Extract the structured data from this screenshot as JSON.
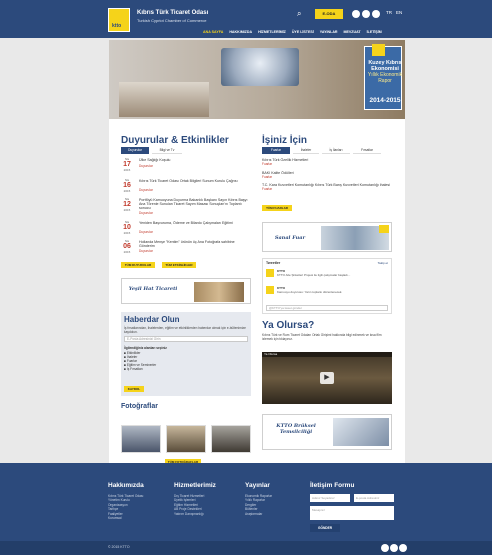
{
  "header": {
    "logo_text": "ktto",
    "title": "Kıbrıs Türk Ticaret Odası",
    "subtitle": "Turkish Cypriot Chamber of Commerce",
    "search_icon": "search-icon",
    "member_button": "E-ODA",
    "social": [
      "facebook-icon",
      "twitter-icon",
      "youtube-icon"
    ],
    "languages": [
      "TR",
      "EN"
    ],
    "nav": [
      "ANA SAYFA",
      "HAKKIMIZDA",
      "HİZMETLERİMİZ",
      "ÜYE LİSTESİ",
      "YAYINLAR",
      "MEVZUAT",
      "İLETİŞİM"
    ]
  },
  "banner": {
    "book_title": "Kuzey Kıbrıs Ekonomisi",
    "book_subtitle": "Yıllık Ekonomik Rapor",
    "book_years": "2014-2015"
  },
  "announcements": {
    "title": "Duyurular & Etkinlikler",
    "tabs": [
      "Duyurular",
      "Bilgi ve Tv"
    ],
    "events": [
      {
        "month": "Nis",
        "day": "17",
        "year": "2015",
        "title": "Ülke Sağlığı Koşulu",
        "category": "Duyurular"
      },
      {
        "month": "Nis",
        "day": "16",
        "year": "2015",
        "title": "Kıbrıs Türk Ticaret Odası Ortak Bilgileri Sunum Kurulu Çağrısı",
        "category": "Duyurular"
      },
      {
        "month": "Nis",
        "day": "12",
        "year": "2015",
        "title": "Portföyü Kamuoyuna Duyurma Bakanlık Başkanı Sayın Kıbrıs Başyı Ana Törenle Sunulan Ticaret Sayım Masası Sonuçları'nı Toplantı sonucu",
        "category": "Duyurular"
      },
      {
        "month": "Nis",
        "day": "10",
        "year": "2015",
        "title": "Yeniden Başvuruma, Ödeme ve Bilardo Çalışmaları Eğitimi",
        "category": "Duyurular"
      },
      {
        "month": "Nis",
        "day": "06",
        "year": "2015",
        "title": "Hollanda Menşe \"Kentim\" ürünün üç Ana Fotoğrafa sahibine Gönderim",
        "category": "Duyurular"
      }
    ],
    "btn_all": "TÜM DUYURULAR",
    "btn_events": "TÜM ETKİNLİKLER"
  },
  "jobs": {
    "title": "İşiniz İçin",
    "tabs": [
      "Fuarlar",
      "İhaleler",
      "İş İlanları",
      "Fırsatlar"
    ],
    "items": [
      {
        "title": "Kıbrıs Türk Özellik Hizmetleri",
        "category": "Fuarlar"
      },
      {
        "title": "BAKI Kalite Ödülleri",
        "category": "Fuarlar"
      },
      {
        "title": "T.C. Kara Kuvvetleri Komutanlığı Kıbrıs Türk Barış Kuvvetleri Komutanlığı ihalesi",
        "category": "Fuarlar"
      }
    ],
    "btn_all": "TÜM FUARLAR"
  },
  "promo": {
    "fair_label": "Sanal Fuar",
    "trade_label": "Yeşil Hat Ticareti",
    "brussels_label": "KTTO Brüksel Temsilciliği"
  },
  "twitter": {
    "header": "Tweetler",
    "follow": "Takip et",
    "tweets": [
      {
        "user": "KTTO",
        "text": "KTTO Aile Şirketleri Projesi ile ilgili çalışmalar başladı..."
      },
      {
        "user": "KTTO",
        "text": "Kamuoyu duyurusu: Yarın toplantı düzenlenecek."
      }
    ],
    "compose": "@KTTO'ya tweet gönder"
  },
  "newsletter": {
    "title": "Haberdar Olun",
    "desc": "İş fırsatlarından, ihalelerden, eğitim ve etkinliklerden haberdar olmak için e-bültenimize kaydolun.",
    "email_placeholder": "E-Posta Adresinizi Girin",
    "interests_label": "İlgilendiğiniz alanları seçiniz",
    "options": [
      "Etkinlikler",
      "İhaleler",
      "Fuarlar",
      "Eğitim ve Seminerler",
      "İş Fırsatları"
    ],
    "submit": "KAYDOL"
  },
  "whatif": {
    "title": "Ya Olursa?",
    "desc": "Kıbrıs Türk ve Rum Ticaret Odaları Ortak Girişimi hakkında bilgi edinmek ve kısa film izlemek için tıklayınız.",
    "video_label": "Ya Olursa"
  },
  "photos": {
    "title": "Fotoğraflar",
    "btn_all": "TÜM FOTOĞRAFLAR"
  },
  "footer": {
    "about": {
      "title": "Hakkımızda",
      "links": [
        "Kıbrıs Türk Ticaret Odası",
        "Yönetim Kurulu",
        "Organizasyon",
        "Tarihçe",
        "Faaliyetler",
        "Kurumsal"
      ]
    },
    "services": {
      "title": "Hizmetlerimiz",
      "links": [
        "Dış Ticaret Hizmetleri",
        "Üyelik İşlemleri",
        "Eğitim Hizmetleri",
        "AB Proje Destekleri",
        "Yatırım Danışmanlığı"
      ]
    },
    "publications": {
      "title": "Yayınlar",
      "links": [
        "Ekonomik Raporlar",
        "Yıllık Raporlar",
        "Dergiler",
        "Bültenler",
        "Araştırmalar"
      ]
    },
    "contact": {
      "title": "İletişim Formu",
      "name_ph": "Adınız Soyadınız",
      "email_ph": "E-posta Adresiniz",
      "message_ph": "Mesajınız",
      "submit": "GÖNDER"
    },
    "copyright": "© 2015 KTTO"
  },
  "colors": {
    "brand_blue": "#2c4a7c",
    "accent_yellow": "#f5d31a",
    "accent_red": "#c0392b"
  }
}
